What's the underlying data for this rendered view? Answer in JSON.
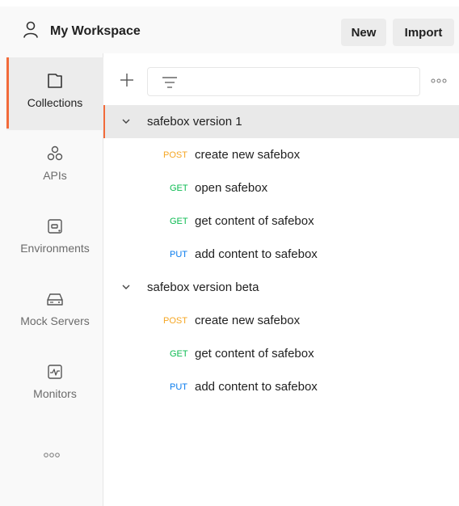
{
  "header": {
    "workspace_title": "My Workspace",
    "new_label": "New",
    "import_label": "Import"
  },
  "sidebar": {
    "items": [
      {
        "label": "Collections",
        "icon": "collections-icon",
        "active": true
      },
      {
        "label": "APIs",
        "icon": "apis-icon",
        "active": false
      },
      {
        "label": "Environments",
        "icon": "environments-icon",
        "active": false
      },
      {
        "label": "Mock Servers",
        "icon": "mock-servers-icon",
        "active": false
      },
      {
        "label": "Monitors",
        "icon": "monitors-icon",
        "active": false
      }
    ],
    "accent_color": "#f26b3a"
  },
  "toolbar": {
    "filter_placeholder": ""
  },
  "method_colors": {
    "POST": "#f5a623",
    "GET": "#0cbb52",
    "PUT": "#097bed"
  },
  "collections": [
    {
      "name": "safebox version 1",
      "expanded": true,
      "selected": true,
      "requests": [
        {
          "method": "POST",
          "name": "create new safebox"
        },
        {
          "method": "GET",
          "name": "open safebox"
        },
        {
          "method": "GET",
          "name": "get content of safebox"
        },
        {
          "method": "PUT",
          "name": "add content to safebox"
        }
      ]
    },
    {
      "name": "safebox version beta",
      "expanded": true,
      "selected": false,
      "requests": [
        {
          "method": "POST",
          "name": "create new safebox"
        },
        {
          "method": "GET",
          "name": "get content of safebox"
        },
        {
          "method": "PUT",
          "name": "add content to safebox"
        }
      ]
    }
  ]
}
